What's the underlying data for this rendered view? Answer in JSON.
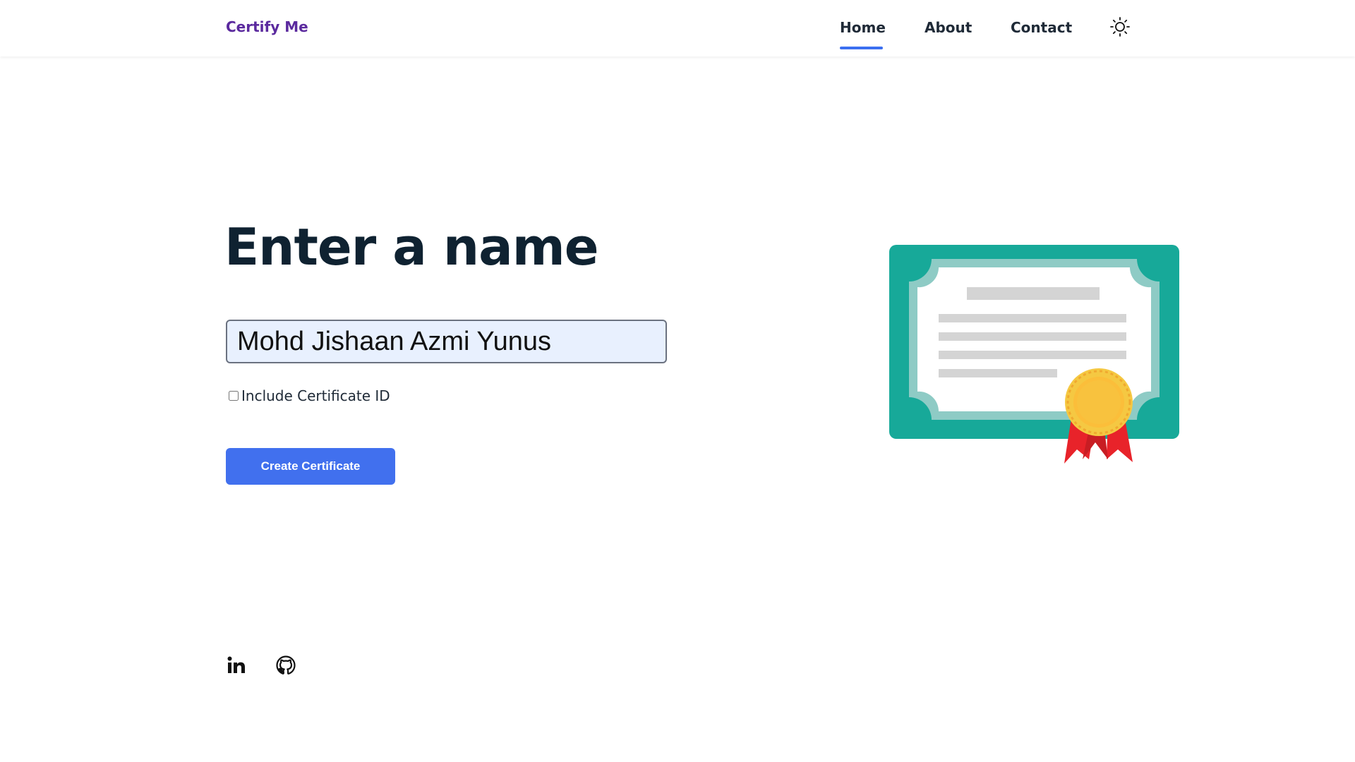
{
  "navbar": {
    "brand": "Certify Me",
    "links": [
      {
        "label": "Home",
        "active": true
      },
      {
        "label": "About",
        "active": false
      },
      {
        "label": "Contact",
        "active": false
      }
    ],
    "theme_toggle_icon": "sun-icon"
  },
  "main": {
    "heading": "Enter a name",
    "name_input": {
      "value": "Mohd Jishaan Azmi Yunus",
      "placeholder": ""
    },
    "include_id": {
      "label": "Include Certificate ID",
      "checked": false
    },
    "create_button": "Create Certificate",
    "illustration_icon": "certificate-icon"
  },
  "footer": {
    "social": [
      {
        "icon": "linkedin-icon"
      },
      {
        "icon": "github-icon"
      }
    ]
  },
  "colors": {
    "brand": "#5b2a9e",
    "accent": "#4170ee",
    "heading": "#0f2231",
    "input_bg": "#e8f0fe",
    "certificate_frame": "#17a999",
    "certificate_inner_frame": "#8ecbc5",
    "seal_gold": "#f5c842",
    "ribbon_red": "#e8232a"
  }
}
